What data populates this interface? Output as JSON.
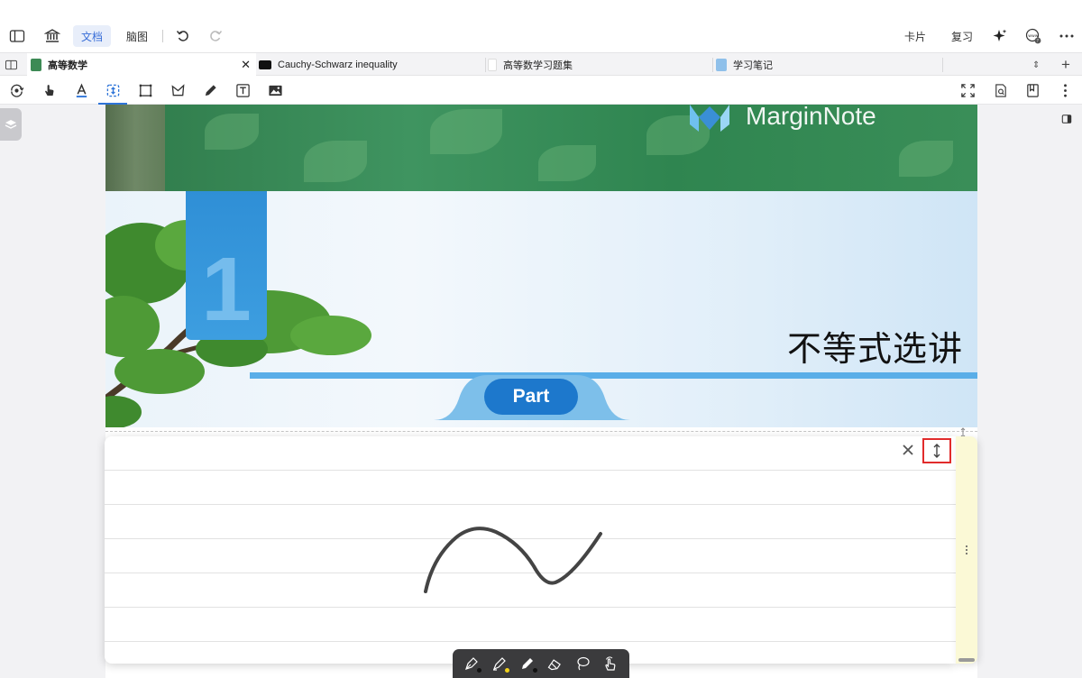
{
  "topbar": {
    "doc_tab": "文档",
    "mindmap_tab": "脑图",
    "cards_label": "卡片",
    "review_label": "复习"
  },
  "tabs": [
    {
      "label": "高等数学",
      "icon": "book-green-icon",
      "active": true
    },
    {
      "label": "Cauchy-Schwarz inequality",
      "icon": "terminal-icon",
      "active": false
    },
    {
      "label": "高等数学习题集",
      "icon": "blank-doc-icon",
      "active": false
    },
    {
      "label": "学习笔记",
      "icon": "blue-notebook-icon",
      "active": false
    }
  ],
  "document": {
    "brand": "MarginNote",
    "chapter_number": "1",
    "chapter_title": "不等式选讲",
    "part_label": "Part"
  },
  "pen_tools": [
    "fountain-pen-icon",
    "highlighter-icon",
    "pencil-icon",
    "eraser-icon",
    "lasso-icon",
    "hand-touch-icon"
  ],
  "colors": {
    "accent": "#2e74d8",
    "highlight_border": "#e12b2b",
    "note_strip": "#fbf9d6",
    "part_blue": "#1d78cc"
  }
}
